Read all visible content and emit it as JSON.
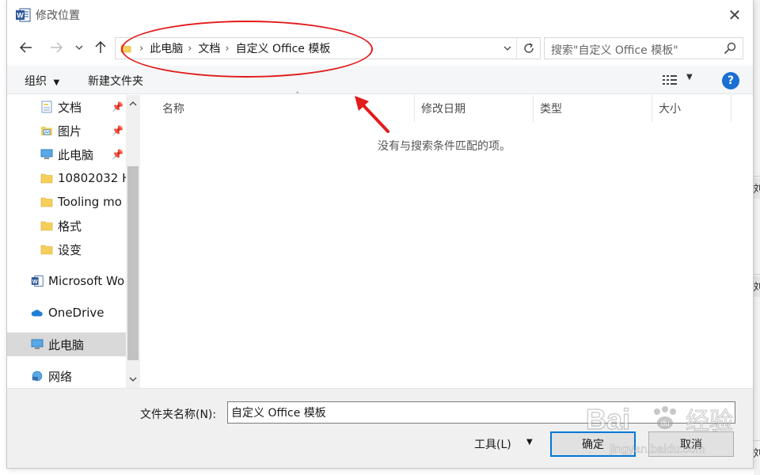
{
  "window": {
    "title": "修改位置"
  },
  "nav": {
    "breadcrumb": [
      "此电脑",
      "文档",
      "自定义 Office 模板"
    ],
    "search_placeholder": "搜索\"自定义 Office 模板\""
  },
  "toolbar": {
    "organize": "组织",
    "new_folder": "新建文件夹"
  },
  "sidebar": {
    "items": [
      {
        "label": "文档",
        "icon": "document-folder-icon",
        "pinned": true
      },
      {
        "label": "图片",
        "icon": "pictures-folder-icon",
        "pinned": true
      },
      {
        "label": "此电脑",
        "icon": "computer-icon",
        "pinned": true
      },
      {
        "label": "10802032 H",
        "icon": "folder-icon",
        "pinned": false
      },
      {
        "label": "Tooling mo",
        "icon": "folder-icon",
        "pinned": false
      },
      {
        "label": "格式",
        "icon": "folder-icon",
        "pinned": false
      },
      {
        "label": "设变",
        "icon": "folder-icon",
        "pinned": false
      },
      {
        "label": "Microsoft Wo",
        "icon": "word-icon",
        "pinned": false
      },
      {
        "label": "OneDrive",
        "icon": "cloud-icon",
        "pinned": false
      },
      {
        "label": "此电脑",
        "icon": "computer-icon",
        "pinned": false,
        "selected": true
      },
      {
        "label": "网络",
        "icon": "network-icon",
        "pinned": false
      }
    ]
  },
  "columns": [
    "名称",
    "修改日期",
    "类型",
    "大小"
  ],
  "empty_message": "没有与搜索条件匹配的项。",
  "footer": {
    "folder_name_label": "文件夹名称(N):",
    "folder_name_value": "自定义 Office 模板",
    "tools_label": "工具(L)",
    "ok_label": "确定",
    "cancel_label": "取消"
  },
  "background_app": {
    "chars": [
      "刘",
      "刘",
      "刘"
    ]
  },
  "watermark": {
    "brand": "Bai",
    "brand_cn": "经验",
    "url": "jingyan.baidu.com"
  },
  "colors": {
    "accent": "#0078d7",
    "annotation": "#e21b1b",
    "help": "#1a6fd1"
  }
}
